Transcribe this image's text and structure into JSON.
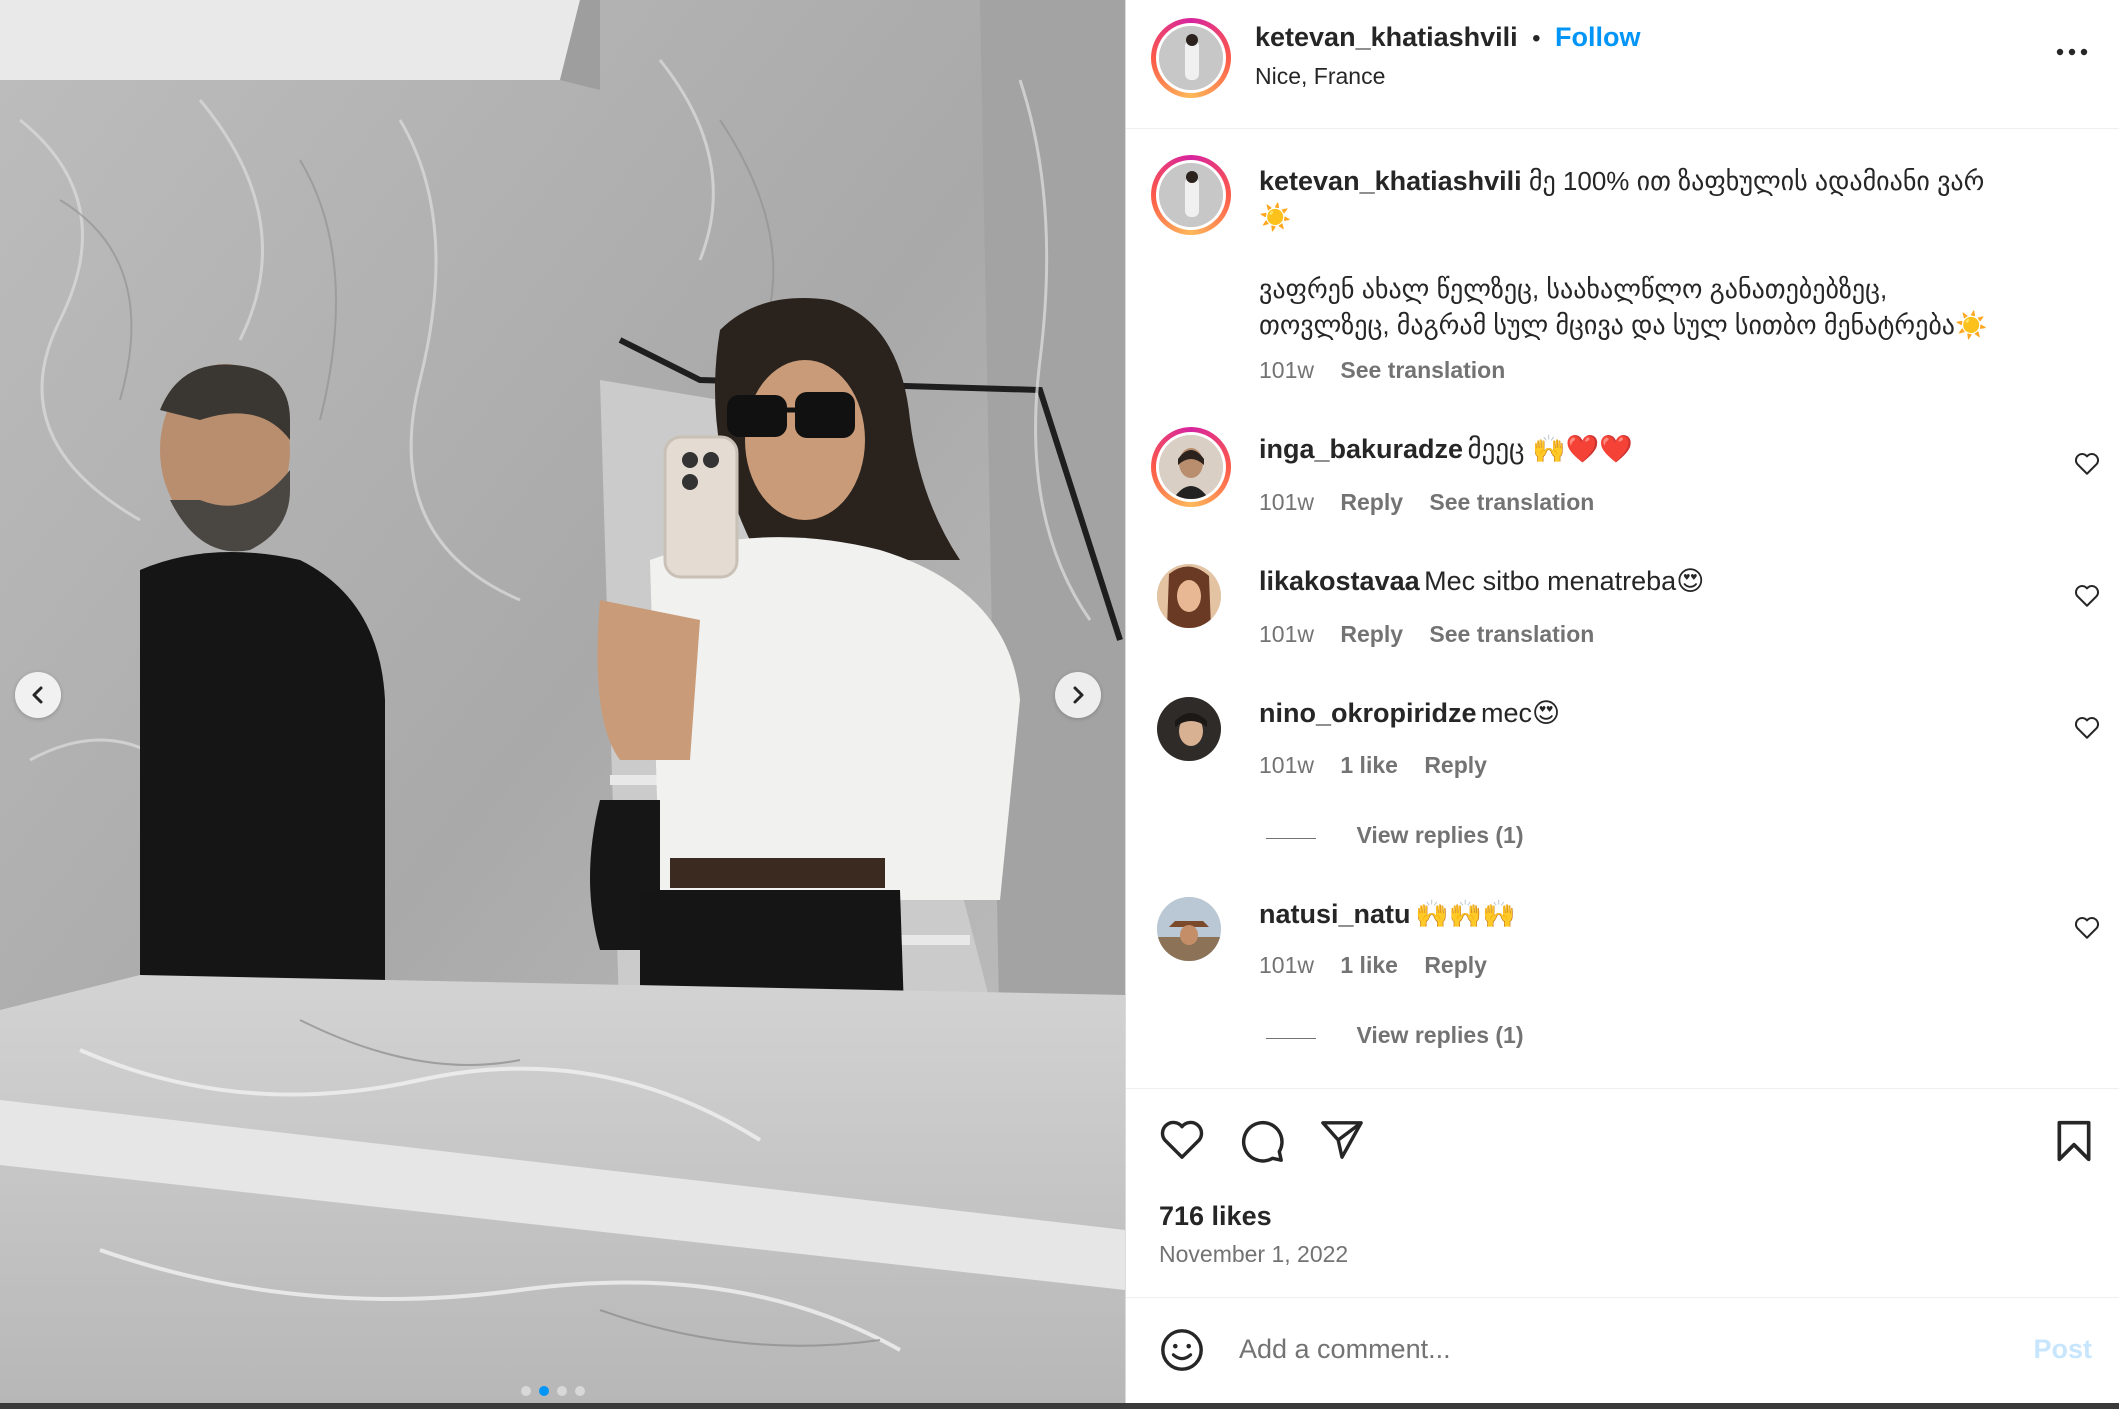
{
  "post": {
    "author": "ketevan_khatiashvili",
    "follow_label": "Follow",
    "separator": "•",
    "location": "Nice, France",
    "caption_line1": "მე 100% ით ზაფხულის ადამიანი ვარ",
    "caption_emoji1": "☀️",
    "caption_line2": "ვაფრენ ახალ წელზეც, საახალწლო განათებებზეც,",
    "caption_line3": "თოვლზეც, მაგრამ სულ მცივა და სულ სითბო მენატრება☀️",
    "caption_time": "101w",
    "see_translation": "See translation"
  },
  "comments": [
    {
      "user": "inga_bakuradze",
      "text": "მეეც 🙌❤️❤️",
      "time": "101w",
      "likes": "",
      "reply": "Reply",
      "translation": "See translation",
      "avatar_color": "#6b5a4e"
    },
    {
      "user": "likakostavaa",
      "text": "Mec sitbo menatreba😍",
      "time": "101w",
      "likes": "",
      "reply": "Reply",
      "translation": "See translation",
      "avatar_color": "#c48a5c"
    },
    {
      "user": "nino_okropiridze",
      "text": "mec😍",
      "time": "101w",
      "likes": "1 like",
      "reply": "Reply",
      "view_replies": "View replies (1)",
      "avatar_color": "#3f3a36"
    },
    {
      "user": "natusi_natu",
      "text": "🙌🙌🙌",
      "time": "101w",
      "likes": "1 like",
      "reply": "Reply",
      "view_replies": "View replies (1)",
      "avatar_color": "#8a6e55"
    }
  ],
  "stats": {
    "likes": "716 likes",
    "date": "November 1, 2022"
  },
  "composer": {
    "placeholder": "Add a comment...",
    "post_label": "Post"
  },
  "carousel": {
    "total": 4,
    "current": 2
  },
  "colors": {
    "accent": "#0095f6",
    "text": "#262626",
    "muted": "#737373"
  }
}
